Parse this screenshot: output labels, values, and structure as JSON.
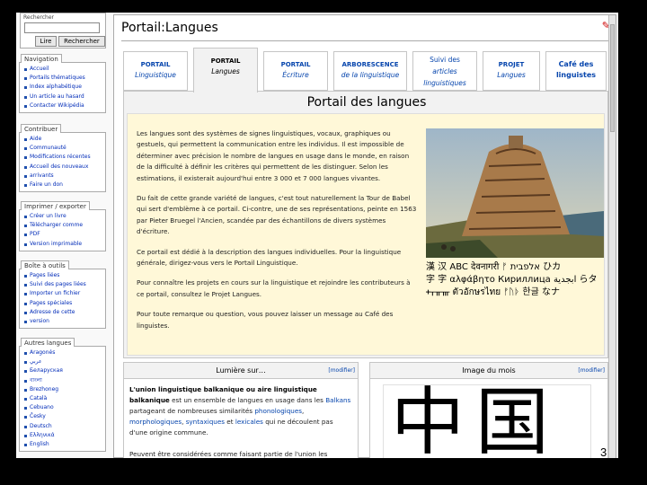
{
  "search": {
    "header": "Rechercher",
    "go_label": "Lire",
    "search_label": "Rechercher"
  },
  "sidebar": {
    "navigation": {
      "title": "Navigation",
      "items": [
        "Accueil",
        "Portails thématiques",
        "Index alphabétique",
        "Un article au hasard",
        "Contacter Wikipédia"
      ]
    },
    "contribuer": {
      "title": "Contribuer",
      "items": [
        "Aide",
        "Communauté",
        "Modifications récentes",
        "Accueil des nouveaux",
        "arrivants",
        "Faire un don"
      ]
    },
    "imprimer": {
      "title": "Imprimer / exporter",
      "items": [
        "Créer un livre",
        "Télécharger comme",
        "PDF",
        "Version imprimable"
      ]
    },
    "outils": {
      "title": "Boîte à outils",
      "items": [
        "Pages liées",
        "Suivi des pages liées",
        "Importer un fichier",
        "Pages spéciales",
        "Adresse de cette",
        "version"
      ]
    },
    "langues": {
      "title": "Autres langues",
      "items": [
        "Aragonés",
        "عربي",
        "Беларуская",
        "বাংলা",
        "Brezhoneg",
        "Català",
        "Cebuano",
        "Česky",
        "Deutsch",
        "Ελληνικά",
        "English"
      ]
    }
  },
  "page": {
    "title": "Portail:Langues",
    "close_mark": "✎"
  },
  "tabs": [
    {
      "line1": "PORTAIL",
      "line2": "Linguistique"
    },
    {
      "line1": "PORTAIL",
      "line2": "Langues"
    },
    {
      "line1": "PORTAIL",
      "line2": "Écriture"
    },
    {
      "line1": "ARBORESCENCE",
      "line2": "de la linguistique"
    },
    {
      "line1": "Suivi des",
      "line2": "articles",
      "line3": "linguistiques"
    },
    {
      "line1": "PROJET",
      "line2": "Langues"
    },
    {
      "line1": "Café des",
      "line2": "linguistes"
    }
  ],
  "portal": {
    "title": "Portail des langues",
    "p1": "Les langues sont des systèmes de signes linguistiques, vocaux, graphiques ou gestuels, qui permettent la communication entre les individus. Il est impossible de déterminer avec précision le nombre de langues en usage dans le monde, en raison de la difficulté à définir les critères qui permettent de les distinguer. Selon les estimations, il existerait aujourd'hui entre 3 000 et 7 000 langues vivantes.",
    "p2": "Du fait de cette grande variété de langues, c'est tout naturellement la Tour de Babel qui sert d'emblème à ce portail. Ci-contre, une de ses représentations, peinte en 1563 par Pieter Bruegel l'Ancien, scandée par des échantillons de divers systèmes d'écriture.",
    "p3": "Ce portail est dédié à la description des langues individuelles. Pour la linguistique générale, dirigez-vous vers le Portail Linguistique.",
    "p4": "Pour connaître les projets en cours sur la linguistique et rejoindre les contributeurs à ce portail, consultez le Projet Langues.",
    "p5": "Pour toute remarque ou question, vous pouvez laisser un message au Café des linguistes.",
    "scripts_line1": "漢 汉 ABC देवनागरी ᚠ אלפבית ひカ",
    "scripts_line2": "字 字 αλφάβητο Кириллица ابجدية らタ",
    "scripts_line3": "ᚐᚁᚂᚃ ตัวอักษรไทย ᚠᚢᚦ 한글 なナ"
  },
  "lumiere": {
    "header": "Lumière sur…",
    "edit": "[modifier]",
    "bold_title": "L'union linguistique balkanique ou aire linguistique balkanique",
    "text1": "est un ensemble de langues en usage dans les",
    "link_balkans": "Balkans",
    "text2": "partageant de nombreuses similarités",
    "link_phono": "phonologiques",
    "link_morpho": "morphologiques",
    "link_synt": "syntaxiques",
    "text3": "et",
    "link_lex": "lexicales",
    "text4": "qui ne découlent pas d'une origine commune.",
    "text5": "Peuvent être considérées comme faisant partie de l'union les langues suivantes :"
  },
  "image_mois": {
    "header": "Image du mois",
    "edit": "[modifier]",
    "characters": "中国"
  },
  "slide_number": "3"
}
